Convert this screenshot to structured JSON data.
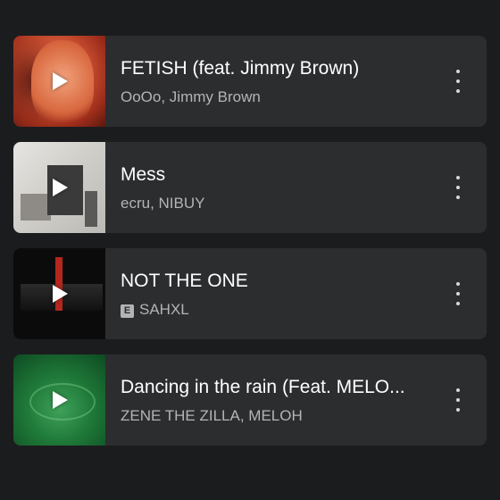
{
  "tracks": [
    {
      "title": "FETISH (feat. Jimmy Brown)",
      "artists": "OoOo, Jimmy Brown",
      "explicit": false,
      "thumb_icon": "album-art-red-portrait"
    },
    {
      "title": "Mess",
      "artists": "ecru, NIBUY",
      "explicit": false,
      "thumb_icon": "album-art-gallery-collage"
    },
    {
      "title": "NOT THE ONE",
      "artists": "SAHXL",
      "explicit": true,
      "explicit_badge": "E",
      "thumb_icon": "album-art-dark-red"
    },
    {
      "title": "Dancing in the rain (Feat. MELO...",
      "artists": "ZENE THE ZILLA, MELOH",
      "explicit": false,
      "thumb_icon": "album-art-green-eye"
    }
  ],
  "colors": {
    "background": "#1b1c1e",
    "card": "#2c2d2f",
    "title": "#ffffff",
    "subtitle": "#b3b4b6"
  },
  "icons": {
    "play": "play-icon",
    "more": "more-vert-icon"
  }
}
